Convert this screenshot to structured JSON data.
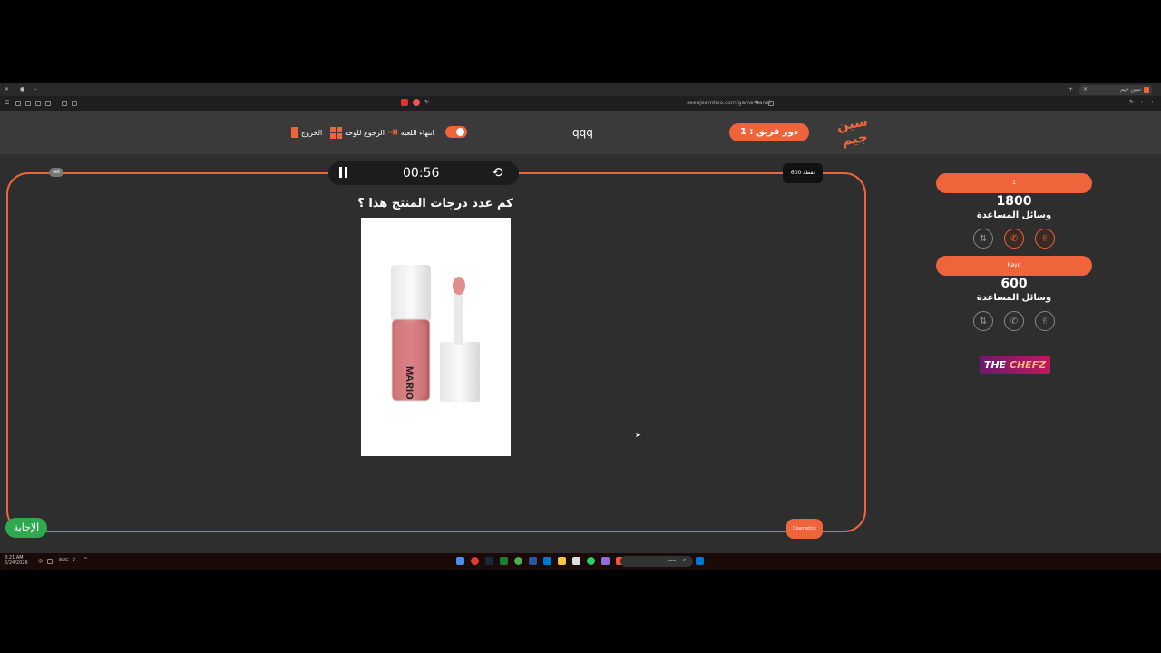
{
  "browser": {
    "tab_title": "سين جيم",
    "url": "seenjeemtwo.com/game-panel"
  },
  "header": {
    "logo_text": "سين جيم",
    "team_turn": "دور فريق : 1",
    "game_name": "qqq",
    "end_game_label": "انتهاء اللعبة",
    "back_to_board_label": "الرجوع للوحة",
    "exit_label": "الخروج"
  },
  "timer": {
    "time": "00:56"
  },
  "question": {
    "points_badge": "600 نقطة",
    "text": "كم عدد درجات المنتج هذا ؟",
    "product_brand": "MARIO",
    "category": "Cosmetics",
    "answer_button": "الإجابة",
    "corner_badge": "GG"
  },
  "teams": [
    {
      "name": "1",
      "score": "1800",
      "aids_label": "وسائل المساعدة",
      "aids_active": true
    },
    {
      "name": "Rayd",
      "score": "600",
      "aids_label": "وسائل المساعدة",
      "aids_active": false
    }
  ],
  "sponsor": {
    "text_a": "THE ",
    "text_b": "CHEFZ"
  },
  "taskbar": {
    "time": "8:21 AM",
    "date": "2/24/2026",
    "lang": "ENG",
    "search_placeholder": "بحث"
  },
  "colors": {
    "accent": "#f0643c",
    "green": "#2fa84f",
    "panel": "#2e2e2e"
  }
}
